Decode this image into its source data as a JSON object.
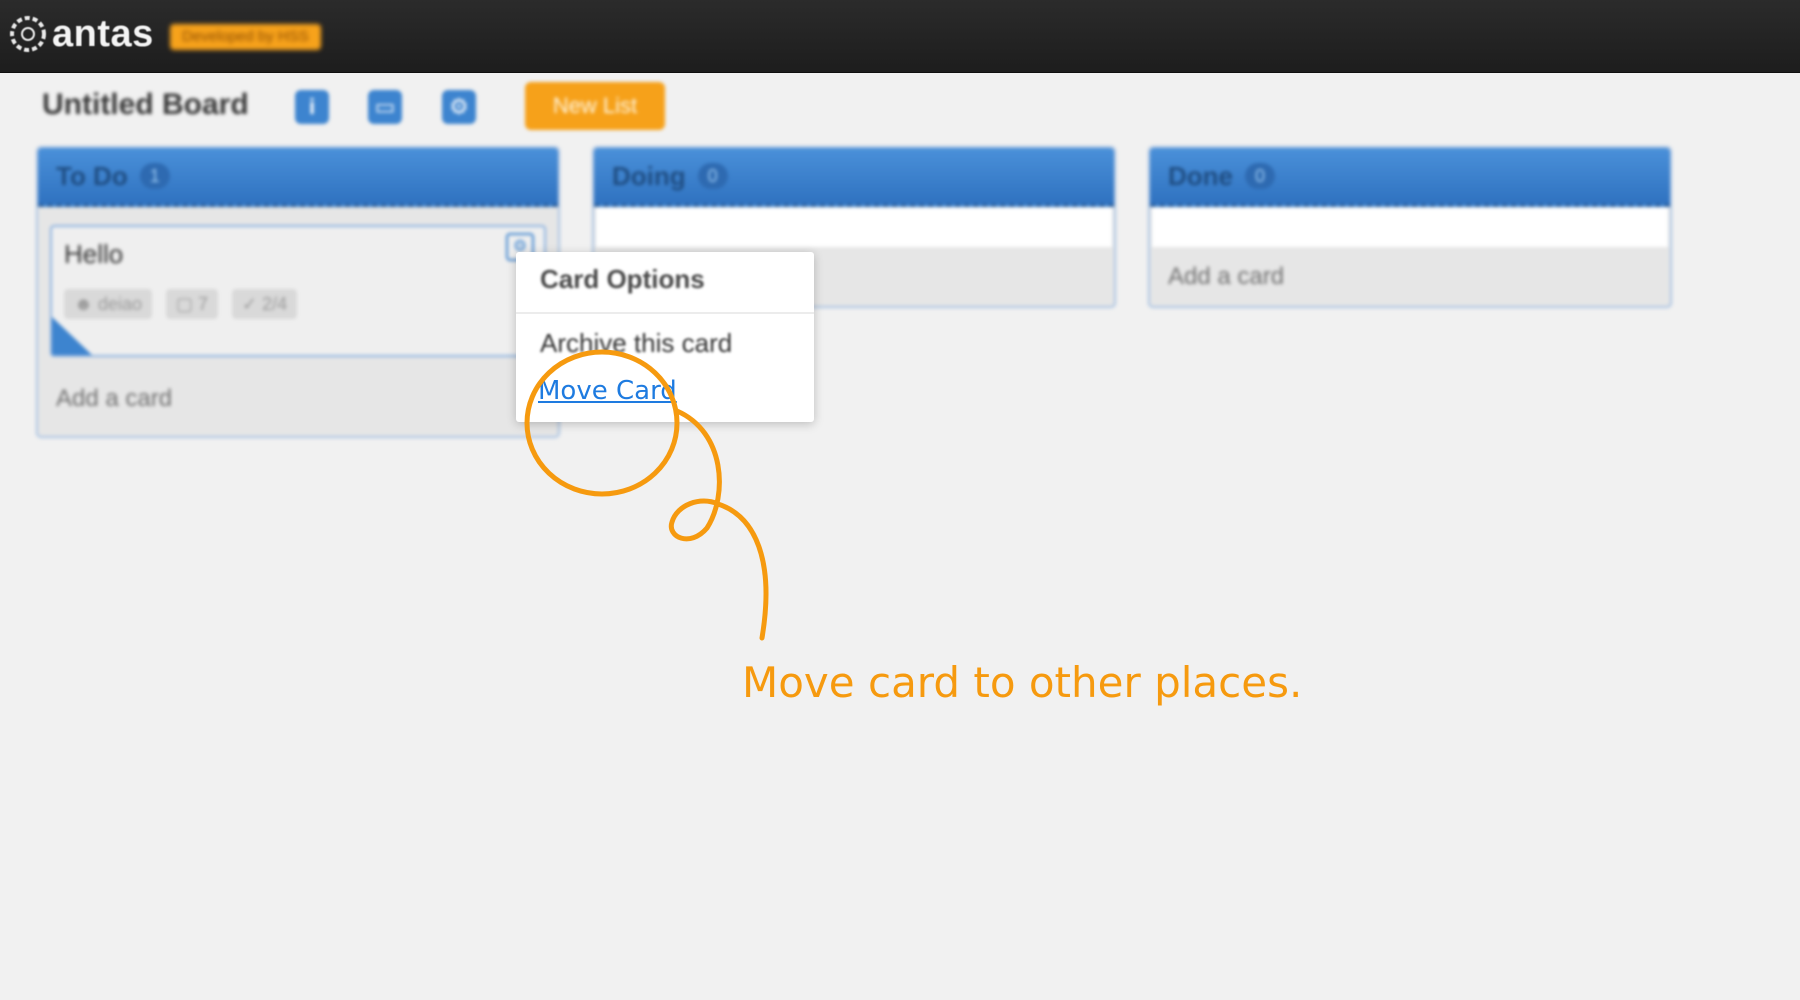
{
  "app": {
    "name": "antas",
    "badge": "Developed by HSS"
  },
  "board": {
    "title": "Untitled Board",
    "tools": [
      {
        "icon": "info-icon",
        "glyph": "i"
      },
      {
        "icon": "save-icon",
        "glyph": "▭"
      },
      {
        "icon": "gear-icon",
        "glyph": "⚙"
      }
    ],
    "new_list_label": "New List"
  },
  "lists": [
    {
      "title": "To Do",
      "count": "1",
      "add_card": "Add a card",
      "cards": [
        {
          "title": "Hello",
          "user": "deiao",
          "comments": "7",
          "checklist": "2/4"
        }
      ]
    },
    {
      "title": "Doing",
      "count": "0",
      "add_card": ""
    },
    {
      "title": "Done",
      "count": "0",
      "add_card": "Add a card"
    }
  ],
  "card_options": {
    "title": "Card Options",
    "archive_label": "Archive this card",
    "move_label": "Move Card"
  },
  "annotation": {
    "text": "Move card to other places.",
    "color": "#f69a0f"
  },
  "colors": {
    "accent_blue": "#3d84cf",
    "accent_orange": "#f6a11a",
    "topbar": "#1d1d1d",
    "background": "#f1f1f1",
    "link": "#1e7be0"
  }
}
